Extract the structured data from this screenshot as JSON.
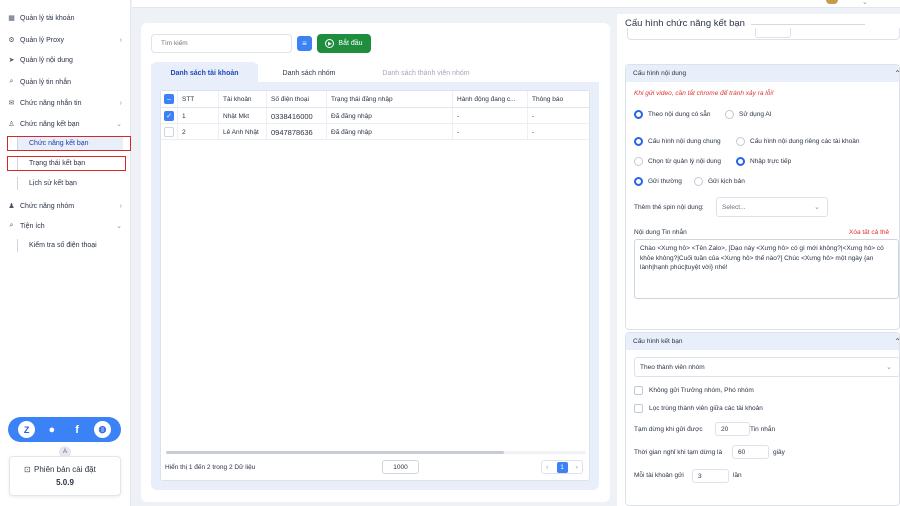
{
  "sidebar": {
    "items": [
      {
        "icon": "grid-icon",
        "glyph": "▦",
        "label": "Quản lý tài khoản"
      },
      {
        "icon": "gear-icon",
        "glyph": "⚙",
        "label": "Quản lý Proxy"
      },
      {
        "icon": "send-icon",
        "glyph": "➤",
        "label": "Quản lý nội dung"
      },
      {
        "icon": "search-icon",
        "glyph": "⌕",
        "label": "Quản lý tin nhắn"
      },
      {
        "icon": "chat-icon",
        "glyph": "✉",
        "label": "Chức năng nhắn tin"
      },
      {
        "icon": "user-add-icon",
        "glyph": "♙",
        "label": "Chức năng kết bạn"
      },
      {
        "icon": "users-icon",
        "glyph": "♟",
        "label": "Chức năng nhóm"
      },
      {
        "icon": "apps-icon",
        "glyph": "⌕",
        "label": "Tiện ích"
      }
    ],
    "sub_ket_ban": [
      "Chức năng kết bạn",
      "Trạng thái kết bạn",
      "Lịch sử kết bạn"
    ],
    "sub_tien_ich": [
      "Kiểm tra số điện thoại"
    ],
    "social_icons": [
      "zalo-icon",
      "messenger-icon",
      "facebook-icon",
      "globe-icon"
    ],
    "avatar_letter": "A",
    "version_label": "Phiên bản cài đặt",
    "version_value": "5.0.9"
  },
  "left": {
    "search_placeholder": "Tìm kiếm",
    "start_label": "Bắt đầu",
    "tabs": [
      "Danh sách tài khoản",
      "Danh sách nhóm",
      "Danh sách thành viên nhóm"
    ],
    "columns": [
      "STT",
      "Tài khoản",
      "Số điện thoại",
      "Trạng thái đăng nhập",
      "Hành động đang c...",
      "Thông báo"
    ],
    "rows": [
      {
        "checked": true,
        "stt": "1",
        "account": "Nhật Mkt",
        "phone": "0338416000",
        "status": "Đã đăng nhập",
        "action": "-",
        "notice": "-"
      },
      {
        "checked": false,
        "stt": "2",
        "account": "Lê Anh Nhật",
        "phone": "0947878636",
        "status": "Đã đăng nhập",
        "action": "-",
        "notice": "-"
      }
    ],
    "footer_info": "Hiển thị 1 đến 2 trong 2 Dữ liệu",
    "page_size": "1000",
    "current_page": "1"
  },
  "right": {
    "title": "Cấu hình chức năng kết bạn",
    "content_section": {
      "title": "Cấu hình nội dung",
      "warning": "Khi gửi video, cần tắt chrome để tránh xảy ra lỗi!",
      "source_options": [
        "Theo nội dung có sẵn",
        "Sử dụng AI"
      ],
      "scope_options": [
        "Cấu hình nội dung chung",
        "Cấu hình nội dung riêng các tài khoản"
      ],
      "input_options": [
        "Chọn từ quản lý nội dung",
        "Nhập trực tiếp"
      ],
      "send_options": [
        "Gửi thường",
        "Gửi kịch bản"
      ],
      "spin_label": "Thêm thẻ spin nội dung:",
      "spin_placeholder": "Select...",
      "message_label": "Nội dung Tin nhắn",
      "clear_all": "Xóa tất cả thẻ",
      "message_text": "Chào <Xưng hô> <Tên Zalo>, [Dạo này <Xưng hô> có gì mới không?|<Xưng hô> có khỏe không?|Cuối tuần của <Xưng hô> thế nào?] Chúc <Xưng hô> một ngày {an lành|hạnh phúc|tuyệt vời} nhé!"
    },
    "friend_section": {
      "title": "Cấu hình kết bạn",
      "mode_value": "Theo thành viên nhóm",
      "checkboxes": [
        "Không gửi Trưởng nhóm, Phó nhóm",
        "Lọc trùng thành viên giữa các tài khoản"
      ],
      "pause_label": "Tạm dừng khi gửi được",
      "pause_value": "20",
      "pause_unit": "Tin nhắn",
      "rest_label": "Thời gian nghỉ khi tạm dừng là",
      "rest_value": "60",
      "rest_unit": "giây",
      "per_account_label": "Mỗi tài khoản gửi",
      "per_account_value": "3",
      "per_account_unit": "lần"
    }
  }
}
